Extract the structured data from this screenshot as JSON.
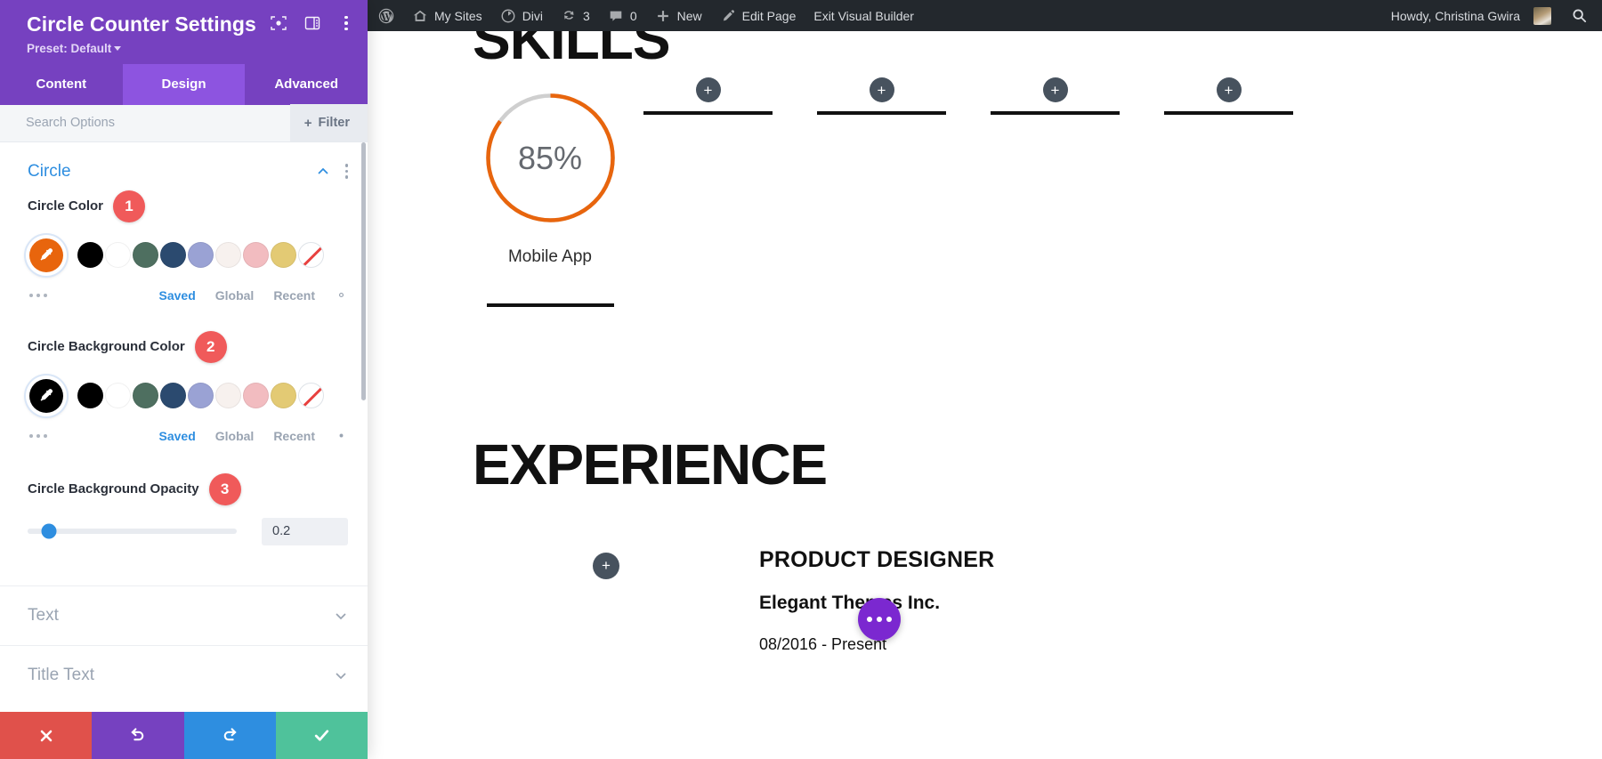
{
  "panel": {
    "title": "Circle Counter Settings",
    "preset": "Preset: Default",
    "tabs": [
      {
        "label": "Content",
        "active": false
      },
      {
        "label": "Design",
        "active": true
      },
      {
        "label": "Advanced",
        "active": false
      }
    ],
    "search": {
      "placeholder": "Search Options",
      "value": ""
    },
    "filter_label": "Filter",
    "section": {
      "title": "Circle",
      "expanded": true
    },
    "fields": [
      {
        "label": "Circle Color",
        "badge": "1",
        "selected_color": "#e8650d",
        "palette": [
          "#000000",
          "#ffffff",
          "#4e6f60",
          "#2b4a6f",
          "#9aa2d4",
          "#f7f1ee",
          "#f2bcc0",
          "#e3ca74"
        ],
        "has_none": true,
        "meta": {
          "saved": "Saved",
          "global": "Global",
          "recent": "Recent"
        }
      },
      {
        "label": "Circle Background Color",
        "badge": "2",
        "selected_color": "#000000",
        "palette": [
          "#000000",
          "#ffffff",
          "#4e6f60",
          "#2b4a6f",
          "#9aa2d4",
          "#f7f1ee",
          "#f2bcc0",
          "#e3ca74"
        ],
        "has_none": true,
        "meta": {
          "saved": "Saved",
          "global": "Global",
          "recent": "Recent"
        }
      }
    ],
    "opacity": {
      "label": "Circle Background Opacity",
      "badge": "3",
      "value": "0.2",
      "percent": 10
    },
    "collapsed_sections": [
      {
        "label": "Text"
      },
      {
        "label": "Title Text"
      }
    ],
    "footer": {
      "cancel": "cancel-icon",
      "undo": "undo-icon",
      "redo": "redo-icon",
      "save": "check-icon"
    },
    "accent": "#7641c0",
    "tab_active_bg": "#8d54e0"
  },
  "adminbar": {
    "items": [
      {
        "icon": "wordpress-logo-icon",
        "label": ""
      },
      {
        "icon": "home-icon",
        "label": "My Sites"
      },
      {
        "icon": "divi-icon",
        "label": "Divi"
      },
      {
        "icon": "updates-icon",
        "label": "3"
      },
      {
        "icon": "comment-icon",
        "label": "0"
      },
      {
        "icon": "plus-icon",
        "label": "New"
      },
      {
        "icon": "pencil-icon",
        "label": "Edit Page"
      },
      {
        "icon": "",
        "label": "Exit Visual Builder"
      }
    ],
    "howdy": "Howdy, Christina Gwira",
    "search_icon": "search-icon"
  },
  "canvas": {
    "skills_heading": "SKILLS",
    "circle_counter": {
      "percent_label": "85%",
      "percent": 85,
      "title": "Mobile App",
      "bar_color": "#e8650d",
      "track_color": "#cfcfcf"
    },
    "placeholder_plus": "+",
    "experience_heading": "EXPERIENCE",
    "experience": {
      "role": "PRODUCT DESIGNER",
      "company": "Elegant Themes Inc.",
      "dates": "08/2016 - Present"
    }
  }
}
